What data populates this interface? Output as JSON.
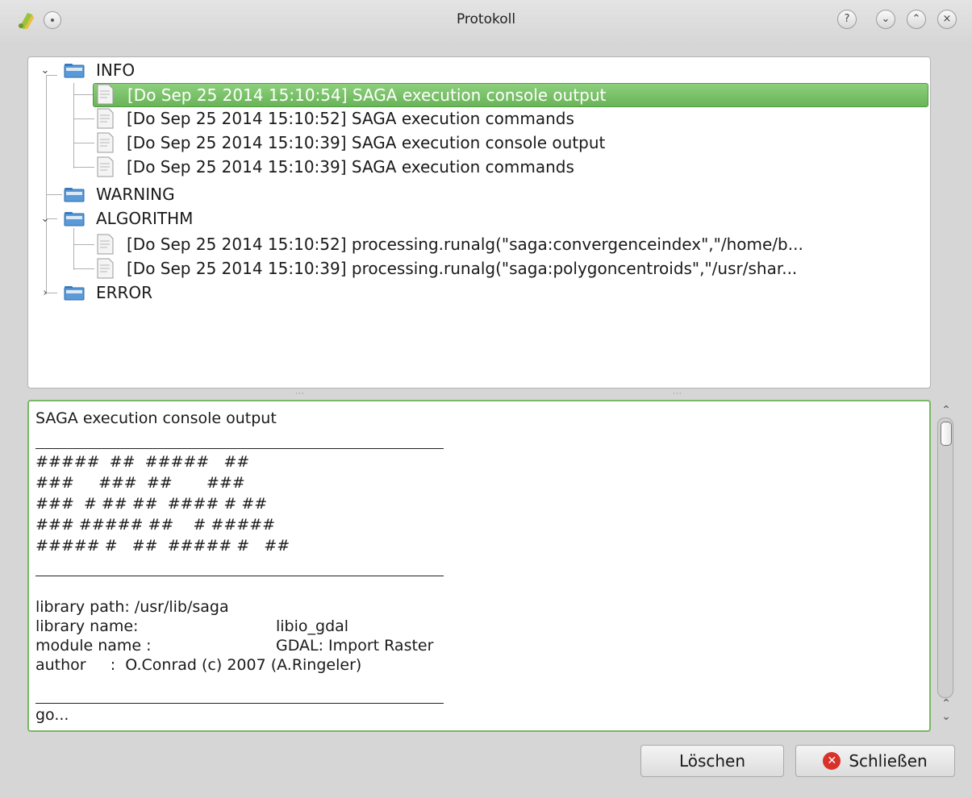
{
  "window": {
    "title": "Protokoll",
    "buttons": {
      "help": "?",
      "minimize": "⌄",
      "maximize": "⌃",
      "close": "×"
    }
  },
  "tree": {
    "groups": [
      {
        "label": "INFO",
        "expanded": true,
        "items": [
          "[Do Sep 25 2014 15:10:54] SAGA execution console output",
          "[Do Sep 25 2014 15:10:52] SAGA execution commands",
          "[Do Sep 25 2014 15:10:39] SAGA execution console output",
          "[Do Sep 25 2014 15:10:39] SAGA execution commands"
        ]
      },
      {
        "label": "WARNING",
        "expanded": false,
        "items": []
      },
      {
        "label": "ALGORITHM",
        "expanded": true,
        "items": [
          "[Do Sep 25 2014 15:10:52] processing.runalg(\"saga:convergenceindex\",\"/home/b...",
          "[Do Sep 25 2014 15:10:39] processing.runalg(\"saga:polygoncentroids\",\"/usr/shar..."
        ]
      },
      {
        "label": "ERROR",
        "expanded": false,
        "items": []
      }
    ],
    "selected": "INFO.0"
  },
  "console": {
    "lines": [
      "SAGA execution console output",
      "#####  ##  #####   ##",
      "###     ###  ##       ###",
      "###  # ## ##  #### # ##",
      "### ##### ##    # #####",
      "##### #   ##  ##### #   ##",
      "library path: /usr/lib/saga",
      "library name:",
      "libio_gdal",
      "module name :",
      "GDAL: Import Raster",
      "author     :  O.Conrad (c) 2007 (A.Ringeler)",
      "go..."
    ]
  },
  "buttons": {
    "clear": "Löschen",
    "close": "Schließen"
  },
  "colors": {
    "selection": "#6cb55a",
    "console_border": "#79b764",
    "close_icon": "#d9322b"
  }
}
